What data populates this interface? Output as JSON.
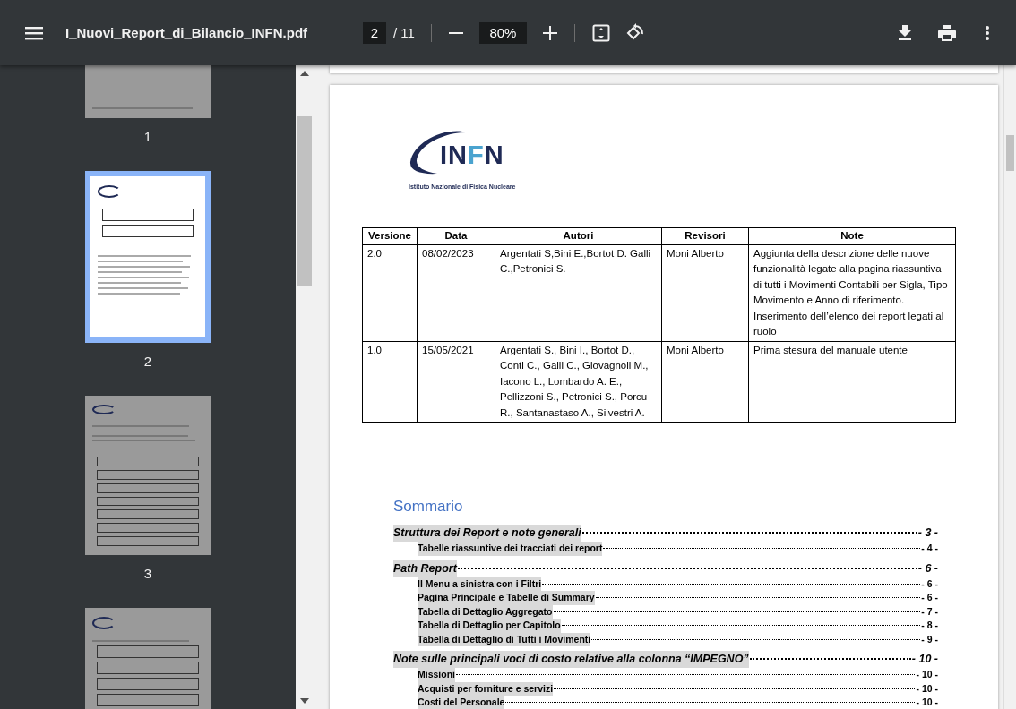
{
  "toolbar": {
    "title": "I_Nuovi_Report_di_Bilancio_INFN.pdf",
    "page_input": "2",
    "page_total": "/ 11",
    "zoom": "80%"
  },
  "thumbnails": [
    {
      "label": "1",
      "selected": false,
      "kind": "blank"
    },
    {
      "label": "2",
      "selected": true,
      "kind": "summary"
    },
    {
      "label": "3",
      "selected": false,
      "kind": "text"
    },
    {
      "selected": false,
      "kind": "table"
    }
  ],
  "page": {
    "logo": {
      "wordmark": "INFN",
      "subtitle": "Istituto Nazionale di Fisica Nucleare"
    },
    "table": {
      "columns": [
        "Versione",
        "Data",
        "Autori",
        "Revisori",
        "Note"
      ],
      "rows": [
        [
          "2.0",
          "08/02/2023",
          "Argentati S,Bini E.,Bortot D. Galli C.,Petronici S.",
          "Moni Alberto",
          "Aggiunta della descrizione delle nuove funzionalità legate alla pagina riassuntiva di tutti i Movimenti Contabili per Sigla, Tipo Movimento e Anno di riferimento. Inserimento dell’elenco dei report legati al ruolo"
        ],
        [
          "1.0",
          "15/05/2021",
          "Argentati S., Bini I., Bortot D., Conti C., Galli C., Giovagnoli M., Iacono L., Lombardo A. E., Pellizzoni S., Petronici S., Porcu R., Santanastaso A., Silvestri A.",
          "Moni Alberto",
          "Prima stesura del manuale utente"
        ]
      ]
    },
    "toc": {
      "title": "Sommario",
      "entries": [
        {
          "text": "Struttura dei Report e note generali",
          "page": "- 3 -",
          "children": [
            {
              "text": "Tabelle riassuntive dei tracciati dei report",
              "page": "- 4 -"
            }
          ]
        },
        {
          "text": "Path Report",
          "page": "- 6 -",
          "children": [
            {
              "text": "Il Menu a sinistra con i Filtri",
              "page": "- 6 -"
            },
            {
              "text": "Pagina Principale e Tabelle di Summary",
              "page": "- 6 -"
            },
            {
              "text": "Tabella di Dettaglio Aggregato",
              "page": "- 7 -"
            },
            {
              "text": "Tabella di Dettaglio per Capitolo",
              "page": "- 8 -"
            },
            {
              "text": "Tabella di Dettaglio di Tutti i Movimenti",
              "page": "- 9 -"
            }
          ]
        },
        {
          "text": "Note sulle principali voci di costo relative alla colonna “IMPEGNO”",
          "page": "- 10 -",
          "children": [
            {
              "text": "Missioni",
              "page": "- 10 -"
            },
            {
              "text": "Acquisti per forniture e servizi",
              "page": "- 10 -"
            },
            {
              "text": "Costi del Personale",
              "page": "- 10 -"
            }
          ]
        }
      ]
    }
  }
}
